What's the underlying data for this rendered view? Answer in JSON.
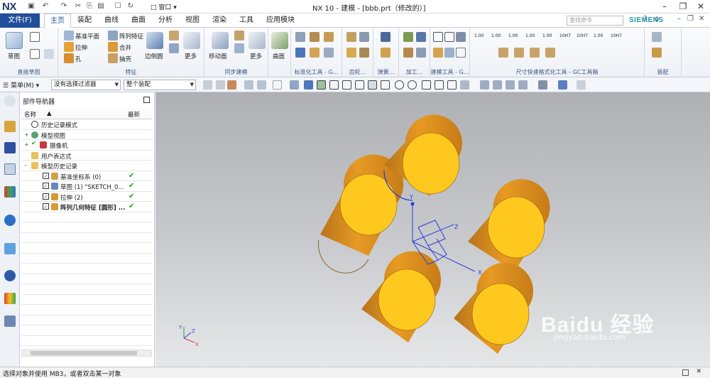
{
  "titlebar": {
    "logo": "NX",
    "window_title": "NX 10 - 建模 - [bbb.prt（修改的）]",
    "window_menu": "窗口",
    "controls": [
      "–",
      "❐",
      "✕"
    ]
  },
  "menubar": {
    "file": "文件(F)",
    "tabs": [
      "主页",
      "装配",
      "曲线",
      "曲面",
      "分析",
      "视图",
      "渲染",
      "工具",
      "应用模块"
    ],
    "active_tab": "主页",
    "search_placeholder": "查找命令",
    "brand": "SIEMENS"
  },
  "ribbon": {
    "groups": [
      {
        "label": "直接草图",
        "items": [
          "草图"
        ]
      },
      {
        "label": "特征",
        "items": [
          "基准平面",
          "阵列特征",
          "拉伸",
          "合并",
          "孔",
          "抽壳",
          "边倒圆",
          "更多"
        ]
      },
      {
        "label": "同步建模",
        "items": [
          "移动面",
          "更多"
        ]
      },
      {
        "label": "曲面",
        "items": [
          "曲面"
        ]
      },
      {
        "label": "标准化工具 - G...",
        "items": []
      },
      {
        "label": "齿轮...",
        "items": []
      },
      {
        "label": "弹簧...",
        "items": []
      },
      {
        "label": "加工...",
        "items": []
      },
      {
        "label": "建模工具 - G...",
        "items": []
      },
      {
        "label": "尺寸快速格式化工具 - GC工具箱",
        "items": [
          "1.00",
          "1.00",
          "1.00",
          "1.00",
          "1.00",
          "10H7",
          "10H7",
          "1.00",
          "10H7"
        ]
      },
      {
        "label": "装配",
        "items": []
      }
    ]
  },
  "selection_bar": {
    "menu": "菜单(M)",
    "filter": "没有选择过滤器",
    "scope": "整个装配"
  },
  "navigator": {
    "title": "部件导航器",
    "col_name": "名称",
    "col_latest": "最新",
    "rows": [
      {
        "label": "历史记录模式"
      },
      {
        "label": "模型视图"
      },
      {
        "label": "摄像机"
      },
      {
        "label": "用户表达式"
      },
      {
        "label": "模型历史记录"
      },
      {
        "label": "基准坐标系 (0)"
      },
      {
        "label": "草图 (1) \"SKETCH_0..."
      },
      {
        "label": "拉伸 (2)"
      },
      {
        "label": "阵列几何特征 [圆形] ..."
      }
    ]
  },
  "viewport": {
    "triad_labels": {
      "x": "X",
      "y": "Y",
      "z": "Z"
    },
    "colors": {
      "cylinder_face": "#ffc81e",
      "cylinder_side": "#e2901a",
      "csys": "#2b3bd6"
    }
  },
  "statusbar": {
    "text": "选择对象并使用 MB3，或者双击某一对象"
  },
  "watermark": {
    "text": "Baidu 经验",
    "url": "jingyan.baidu.com"
  }
}
